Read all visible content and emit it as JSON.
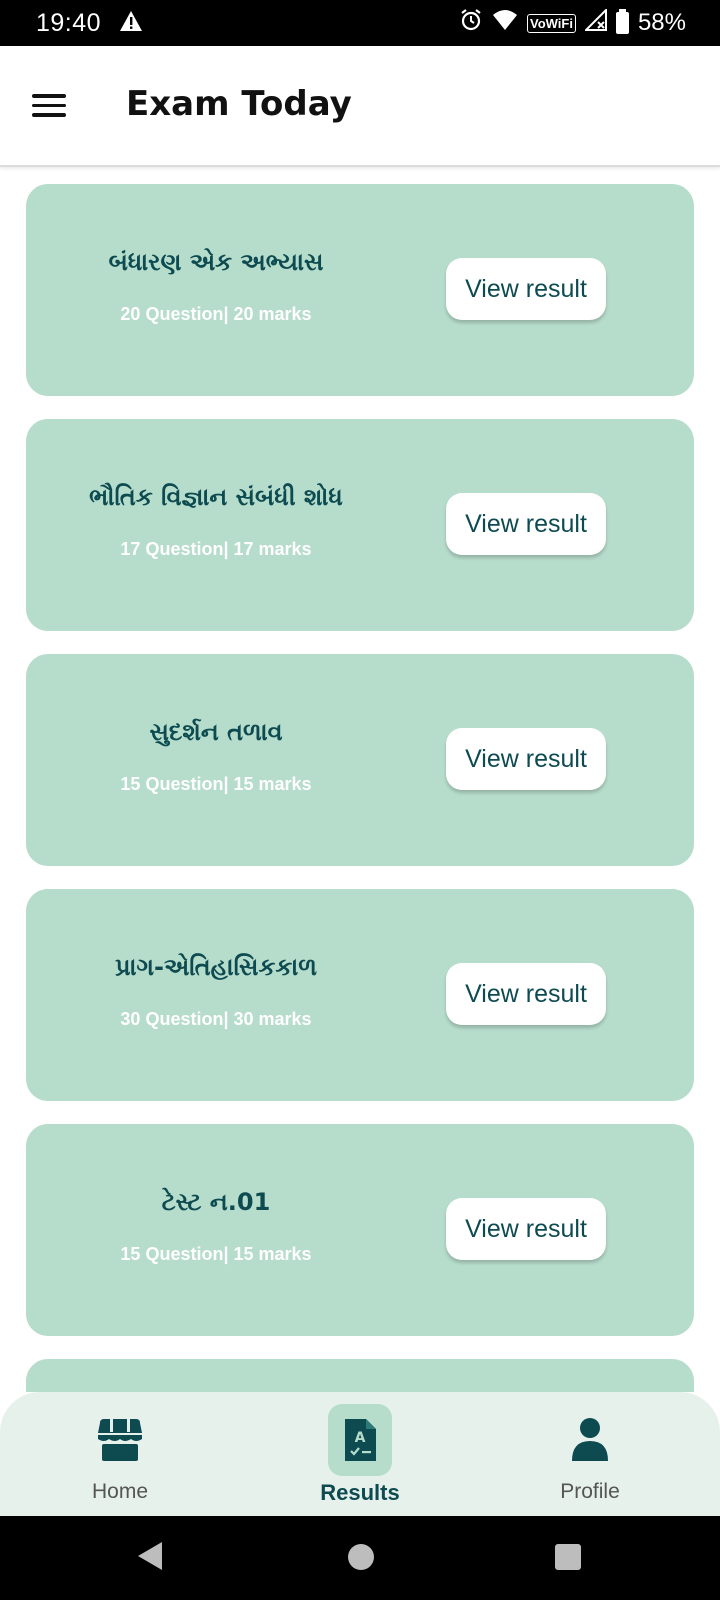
{
  "status_bar": {
    "time": "19:40",
    "battery_pct": "58%",
    "network_label": "VoWiFi",
    "icons": [
      "warning-icon",
      "alarm-icon",
      "wifi-icon",
      "signal-icon",
      "battery-icon"
    ]
  },
  "app_bar": {
    "title": "Exam Today",
    "menu_icon": "hamburger-menu-icon"
  },
  "results": [
    {
      "title": "બંધારણ એક અભ્યાસ",
      "meta": "20 Question| 20 marks",
      "button": "View result"
    },
    {
      "title": "ભૌતિક વિજ્ઞાન સંબંધી શોધ",
      "meta": "17 Question| 17 marks",
      "button": "View result"
    },
    {
      "title": "સુદર્શન તળાવ",
      "meta": "15 Question| 15 marks",
      "button": "View result"
    },
    {
      "title": "પ્રાગ-એતિહાસિકકાળ",
      "meta": "30 Question| 30 marks",
      "button": "View result"
    },
    {
      "title": "ટેસ્ટ ન.01",
      "meta": "15 Question| 15 marks",
      "button": "View result"
    }
  ],
  "bottom_nav": {
    "items": [
      {
        "label": "Home",
        "icon": "home-store-icon",
        "active": false
      },
      {
        "label": "Results",
        "icon": "results-document-icon",
        "active": true
      },
      {
        "label": "Profile",
        "icon": "profile-person-icon",
        "active": false
      }
    ]
  },
  "colors": {
    "card_bg": "#b6dccb",
    "accent": "#0d4b51",
    "nav_bg": "#e6f1ec"
  }
}
